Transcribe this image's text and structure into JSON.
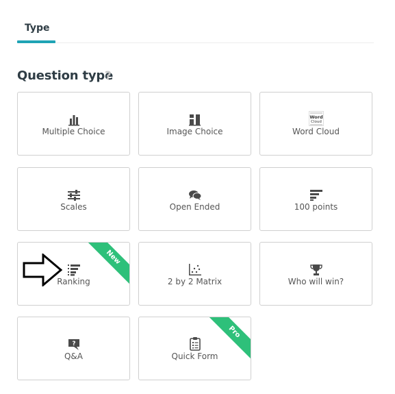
{
  "tabs": [
    {
      "label": "Type"
    }
  ],
  "section": {
    "title": "Question type",
    "help": "?"
  },
  "cards": [
    {
      "label": "Multiple Choice",
      "icon": "bar-chart-icon"
    },
    {
      "label": "Image Choice",
      "icon": "image-choice-icon"
    },
    {
      "label": "Word Cloud",
      "icon": "word-cloud-icon",
      "icon_text": [
        "Word",
        "Cloud"
      ]
    },
    {
      "label": "Scales",
      "icon": "sliders-icon"
    },
    {
      "label": "Open Ended",
      "icon": "speech-bubbles-icon"
    },
    {
      "label": "100 points",
      "icon": "horizontal-bars-icon"
    },
    {
      "label": "Ranking",
      "icon": "ranking-icon",
      "badge": "New"
    },
    {
      "label": "2 by 2 Matrix",
      "icon": "scatter-matrix-icon"
    },
    {
      "label": "Who will win?",
      "icon": "trophy-icon"
    },
    {
      "label": "Q&A",
      "icon": "question-box-icon",
      "icon_text": "?"
    },
    {
      "label": "Quick Form",
      "icon": "clipboard-form-icon",
      "badge": "Pro"
    }
  ],
  "colors": {
    "accent": "#1fa3b5",
    "badge": "#2ec07a",
    "icon": "#4a4a4a"
  },
  "annotation": {
    "icon": "arrow-right-icon"
  }
}
